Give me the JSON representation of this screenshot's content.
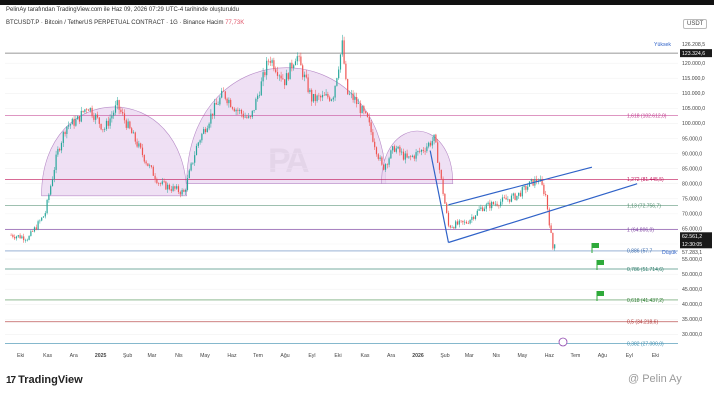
{
  "header": {
    "published": "PelinAy tarafından TradingView.com ile Haz 09, 2026 07:29 UTC-4 tarihinde oluşturuldu",
    "symbol": "BTCUSDT.P · Bitcoin / TetherUS PERPETUAL CONTRACT · 1G · Binance  Hacim",
    "volume": "77,73K",
    "currency": "USDT"
  },
  "footer": {
    "logo_text": "TradingView",
    "logo_mark": "17",
    "author": "@ Pelin Ay"
  },
  "watermark": {
    "text": "PA"
  },
  "chart_data": {
    "type": "line",
    "title": "BTCUSDT.P · Bitcoin / TetherUS PERPETUAL CONTRACT · 1G · Binance",
    "y_axis_ticks": [
      "120.000,0",
      "115.000,0",
      "110.000,0",
      "105.000,0",
      "100.000,0",
      "95.000,0",
      "90.000,0",
      "85.000,0",
      "80.000,0",
      "75.000,0",
      "70.000,0",
      "65.000,0",
      "60.000,0",
      "55.000,0",
      "50.000,0",
      "45.000,0",
      "40.000,0",
      "35.000,0",
      "30.000,0"
    ],
    "x_axis_ticks": [
      "Eki",
      "Kas",
      "Ara",
      "2025",
      "Şub",
      "Mar",
      "Nis",
      "May",
      "Haz",
      "Tem",
      "Ağu",
      "Eyl",
      "Eki",
      "Kas",
      "Ara",
      "2026",
      "Şub",
      "Mar",
      "Nis",
      "May",
      "Haz",
      "Tem",
      "Ağu",
      "Eyl",
      "Eki"
    ],
    "ylim": [
      26000,
      130000
    ],
    "price_labels": {
      "high_label": "Yüksek",
      "high_value": "126.208,5",
      "resistance_value": "123.324,6",
      "last_price": "62.561,2",
      "countdown": "12:30:05",
      "low_label": "Düşük",
      "low_value": "57.283,1"
    },
    "fib_levels": [
      {
        "label": "1,618 (102.612,0)",
        "value": 102612,
        "color": "#c23b8e"
      },
      {
        "label": "1,272 (81.445,5)",
        "value": 81445.5,
        "color": "#c2185b"
      },
      {
        "label": "1,13 (72.756,7)",
        "value": 72756.7,
        "color": "#4a8a6a"
      },
      {
        "label": "1 (64.806,0)",
        "value": 64806,
        "color": "#7b3fa0"
      },
      {
        "label": "0,886 (57.7",
        "value": 57700,
        "color": "#3f6fb0"
      },
      {
        "label": "0,786 (51.714,6)",
        "value": 51714.6,
        "color": "#2e7d6b"
      },
      {
        "label": "0,618 (41.437,2)",
        "value": 41437.2,
        "color": "#2e7d32"
      },
      {
        "label": "0,5 (34.218,6)",
        "value": 34218.6,
        "color": "#b23a3a"
      },
      {
        "label": "0,382 (27.000,0)",
        "value": 27000,
        "color": "#3f8fb0"
      }
    ],
    "series": [
      {
        "x": [
          "2024-09-20",
          "2024-10-10",
          "2024-10-29",
          "2024-11-12",
          "2024-11-22",
          "2024-12-05",
          "2024-12-17",
          "2025-01-05",
          "2025-01-20",
          "2025-02-05",
          "2025-02-25",
          "2025-03-10",
          "2025-04-07",
          "2025-04-22",
          "2025-05-10",
          "2025-05-22",
          "2025-06-05",
          "2025-06-22",
          "2025-07-14",
          "2025-08-01",
          "2025-08-14",
          "2025-09-01",
          "2025-09-25",
          "2025-10-06",
          "2025-10-11",
          "2025-10-20",
          "2025-11-04",
          "2025-11-21",
          "2025-12-05",
          "2025-12-20",
          "2026-01-05",
          "2026-01-20",
          "2026-02-05",
          "2026-02-25",
          "2026-03-15",
          "2026-04-05",
          "2026-04-25",
          "2026-05-10",
          "2026-05-20",
          "2026-05-28",
          "2026-06-05",
          "2026-06-09"
        ],
        "values": [
          63000,
          62000,
          70000,
          90000,
          99000,
          101000,
          106000,
          98000,
          106000,
          97000,
          86000,
          80000,
          77000,
          93000,
          104000,
          110000,
          105000,
          101000,
          122000,
          114000,
          123000,
          108000,
          109000,
          126208,
          110000,
          108000,
          101000,
          85000,
          92000,
          88000,
          91000,
          95000,
          66000,
          67000,
          72000,
          74000,
          76000,
          80000,
          81500,
          76000,
          58500,
          62561
        ]
      }
    ],
    "shapes": {
      "pattern": "Omuz Baş Omuz",
      "channel": "rising channel"
    },
    "colors": {
      "bull": "#26a69a",
      "bear": "#ef5350",
      "pattern_fill": "#e9d5f0",
      "channel": "#2f62c8",
      "price_tag": "#1a1a1a"
    }
  }
}
